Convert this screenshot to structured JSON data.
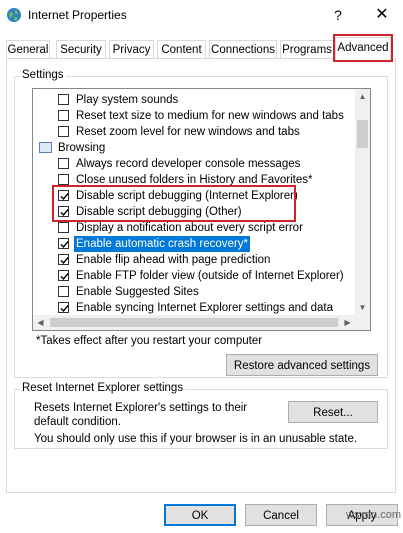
{
  "window": {
    "title": "Internet Properties",
    "help_glyph": "?",
    "close_glyph": "✕"
  },
  "tabs": [
    {
      "label": "General"
    },
    {
      "label": "Security"
    },
    {
      "label": "Privacy"
    },
    {
      "label": "Content"
    },
    {
      "label": "Connections"
    },
    {
      "label": "Programs"
    },
    {
      "label": "Advanced",
      "active": true
    }
  ],
  "settings": {
    "group_label": "Settings",
    "items": [
      {
        "type": "check",
        "label": "Play system sounds",
        "checked": false
      },
      {
        "type": "check",
        "label": "Reset text size to medium for new windows and tabs",
        "checked": false
      },
      {
        "type": "check",
        "label": "Reset zoom level for new windows and tabs",
        "checked": false
      },
      {
        "type": "category",
        "label": "Browsing",
        "icon": "folder-icon"
      },
      {
        "type": "check",
        "label": "Always record developer console messages",
        "checked": false
      },
      {
        "type": "check",
        "label": "Close unused folders in History and Favorites*",
        "checked": false
      },
      {
        "type": "check",
        "label": "Disable script debugging (Internet Explorer)",
        "checked": true
      },
      {
        "type": "check",
        "label": "Disable script debugging (Other)",
        "checked": true
      },
      {
        "type": "check",
        "label": "Display a notification about every script error",
        "checked": false
      },
      {
        "type": "check",
        "label": "Enable automatic crash recovery*",
        "checked": true,
        "selected": true
      },
      {
        "type": "check",
        "label": "Enable flip ahead with page prediction",
        "checked": true
      },
      {
        "type": "check",
        "label": "Enable FTP folder view (outside of Internet Explorer)",
        "checked": true
      },
      {
        "type": "check",
        "label": "Enable Suggested Sites",
        "checked": false
      },
      {
        "type": "check",
        "label": "Enable syncing Internet Explorer settings and data",
        "checked": true
      }
    ],
    "note": "*Takes effect after you restart your computer",
    "restore_label": "Restore advanced settings"
  },
  "reset": {
    "group_label": "Reset Internet Explorer settings",
    "description": "Resets Internet Explorer's settings to their default condition.",
    "button_label": "Reset...",
    "note": "You should only use this if your browser is in an unusable state."
  },
  "buttons": {
    "ok": "OK",
    "cancel": "Cancel",
    "apply": "Apply"
  },
  "watermark": "wsxdn.com",
  "colors": {
    "selection": "#0078d7",
    "highlight": "#d2232a",
    "default_button_border": "#0078d7"
  }
}
